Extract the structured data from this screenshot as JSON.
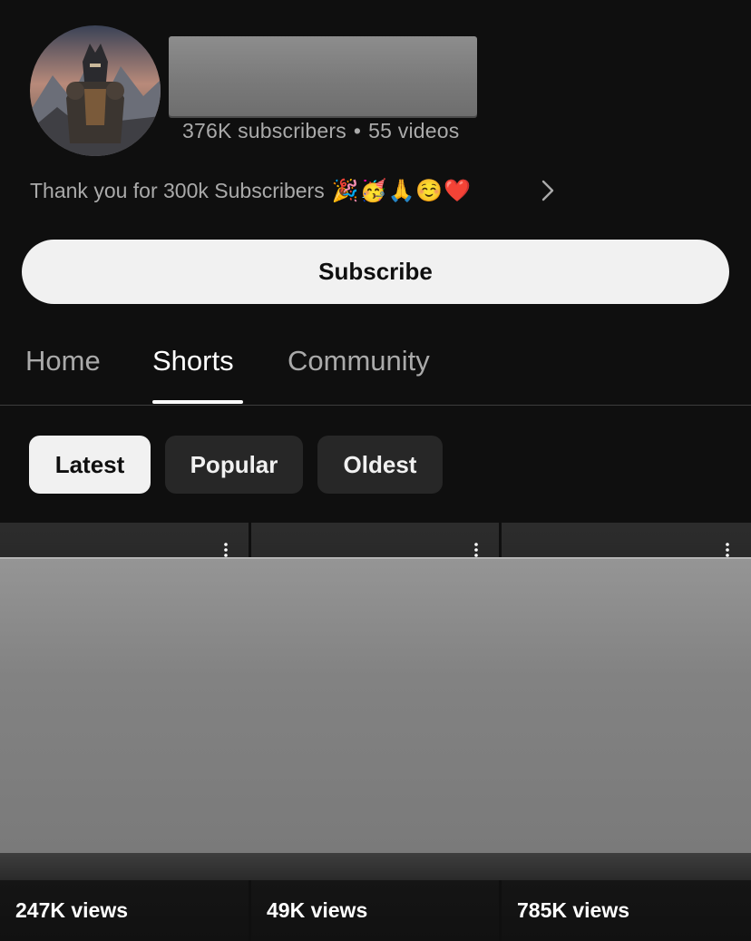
{
  "channel": {
    "avatar_icon": "knight-avatar",
    "subscribers": "376K subscribers",
    "separator": "•",
    "videos": "55 videos",
    "description": "Thank you for 300k Subscribers",
    "description_emoji": "🎉🥳🙏☺️❤️",
    "more_icon": "chevron-right-icon"
  },
  "subscribe_label": "Subscribe",
  "tabs": [
    {
      "label": "Home",
      "active": false
    },
    {
      "label": "Shorts",
      "active": true
    },
    {
      "label": "Community",
      "active": false
    }
  ],
  "filters": [
    {
      "label": "Latest",
      "selected": true
    },
    {
      "label": "Popular",
      "selected": false
    },
    {
      "label": "Oldest",
      "selected": false
    }
  ],
  "shorts": [
    {
      "views": "247K views"
    },
    {
      "views": "49K views"
    },
    {
      "views": "785K views"
    }
  ],
  "colors": {
    "background": "#0f0f0f",
    "button_light": "#f1f1f1",
    "chip_dark": "#272727",
    "secondary_text": "#aaaaaa"
  }
}
